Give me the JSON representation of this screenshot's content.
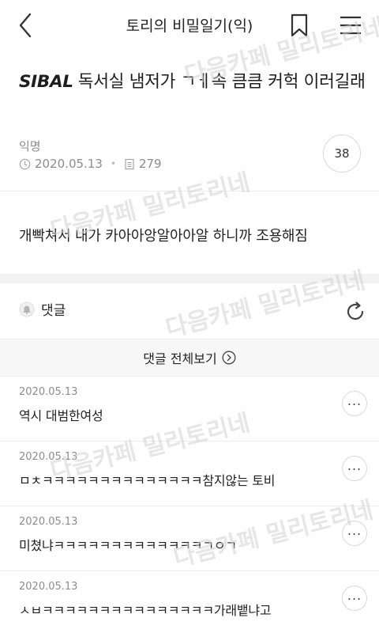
{
  "header": {
    "title": "토리의 비밀일기(익)"
  },
  "post": {
    "title_tag": "SIBAL",
    "title_text": "독서실 냄저가 ㄱㅔ속 큼큼 커헉 이러길래",
    "author": "익명",
    "date": "2020.05.13",
    "views": "279",
    "comment_count": "38",
    "body": "개빡쳐서 내가 카아아앙알아아알 하니까 조용해짐"
  },
  "comments_section": {
    "label": "댓글",
    "view_all": "댓글 전체보기",
    "more_glyph": "...",
    "items": [
      {
        "date": "2020.05.13",
        "text": "역시 대범한여성"
      },
      {
        "date": "2020.05.13",
        "text": "ㅁㅊㅋㅋㅋㅋㅋㅋㅋㅋㅋㅋㅋㅋㅋㅋ참지않는 토비"
      },
      {
        "date": "2020.05.13",
        "text": "미쳤냐ㅋㅋㅋㅋㅋㅋㅋㅋㅋㅋㅋㅋㅋㄱㅇㄱ"
      },
      {
        "date": "2020.05.13",
        "text": "ㅅㅂㅋㅋㅋㅋㅋㅋㅋㅋㅋㅋㅋㅋㅋㅋㅋ가래뱉냐고"
      }
    ]
  },
  "watermark": {
    "text": "다음카페 밀리토리네"
  },
  "colors": {
    "text": "#222222",
    "muted": "#8c8c8c",
    "border": "#d9d9d9",
    "section_gap": "#f2f2f2"
  }
}
